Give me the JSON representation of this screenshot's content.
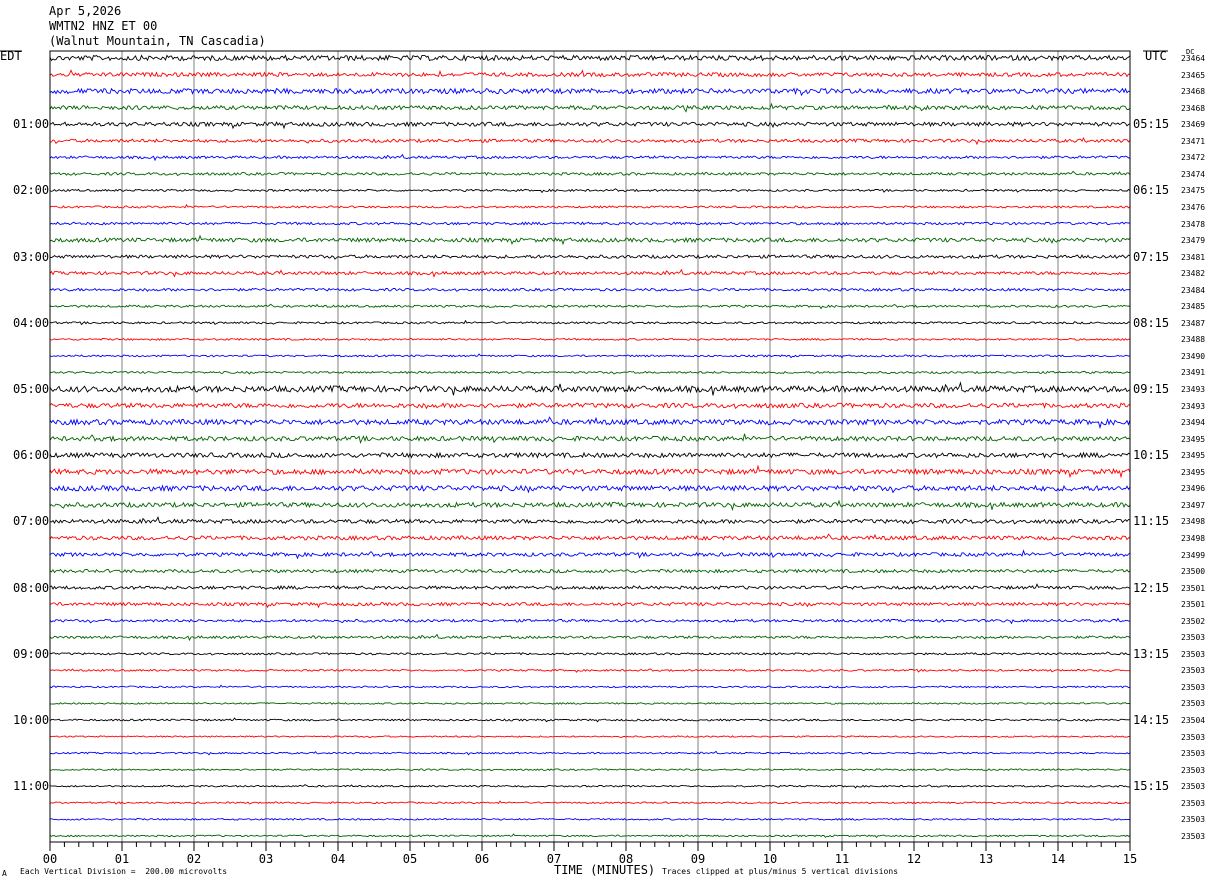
{
  "header": {
    "date": "Apr 5,2026",
    "station": "WMTN2 HNZ ET 00",
    "location": "(Walnut Mountain, TN Cascadia)"
  },
  "left_label": "EDT",
  "right_label": "UTC",
  "dc_label": "DC",
  "footer": {
    "scale_note": "Each Vertical Division =  200.00 microvolts",
    "clip_note": "Traces clipped at plus/minus 5 vertical divisions",
    "corner_mark": "A"
  },
  "colors": {
    "trace_cycle": [
      "#000000",
      "#ff0000",
      "#0000ff",
      "#006400"
    ],
    "grid": "#808080"
  },
  "chart_data": {
    "type": "line",
    "title": "WMTN2 HNZ ET 00",
    "xlabel": "TIME (MINUTES)",
    "x_ticks": [
      "00",
      "01",
      "02",
      "03",
      "04",
      "05",
      "06",
      "07",
      "08",
      "09",
      "10",
      "11",
      "12",
      "13",
      "14",
      "15"
    ],
    "xlim": [
      0,
      15
    ],
    "grid": true,
    "edt_labels": [
      "01:00",
      "02:00",
      "03:00",
      "04:00",
      "05:00",
      "06:00",
      "07:00",
      "08:00",
      "09:00",
      "10:00",
      "11:00"
    ],
    "utc_labels": [
      "05:15",
      "06:15",
      "07:15",
      "08:15",
      "09:15",
      "10:15",
      "11:15",
      "12:15",
      "13:15",
      "14:15",
      "15:15"
    ],
    "dc_offsets": [
      "23464",
      "23465",
      "23468",
      "23468",
      "23469",
      "23471",
      "23472",
      "23474",
      "23475",
      "23476",
      "23478",
      "23479",
      "23481",
      "23482",
      "23484",
      "23485",
      "23487",
      "23488",
      "23490",
      "23491",
      "23493",
      "23493",
      "23494",
      "23495",
      "23495",
      "23495",
      "23496",
      "23497",
      "23498",
      "23498",
      "23499",
      "23500",
      "23501",
      "23501",
      "23502",
      "23503",
      "23503",
      "23503",
      "23503",
      "23503",
      "23504",
      "23503",
      "23503",
      "23503",
      "23503",
      "23503",
      "23503",
      "23503"
    ],
    "trace_amplitude": [
      2.5,
      2.0,
      2.5,
      2.0,
      2.0,
      1.6,
      1.3,
      1.3,
      1.0,
      1.0,
      1.3,
      2.0,
      1.6,
      1.6,
      1.3,
      1.1,
      1.0,
      0.9,
      0.9,
      1.0,
      3.0,
      2.3,
      2.6,
      2.3,
      2.3,
      2.6,
      2.6,
      2.3,
      2.0,
      2.0,
      1.8,
      1.6,
      1.6,
      1.6,
      1.3,
      1.3,
      1.0,
      0.9,
      0.8,
      0.8,
      0.9,
      0.7,
      0.8,
      0.8,
      0.8,
      0.8,
      0.8,
      0.8
    ]
  }
}
